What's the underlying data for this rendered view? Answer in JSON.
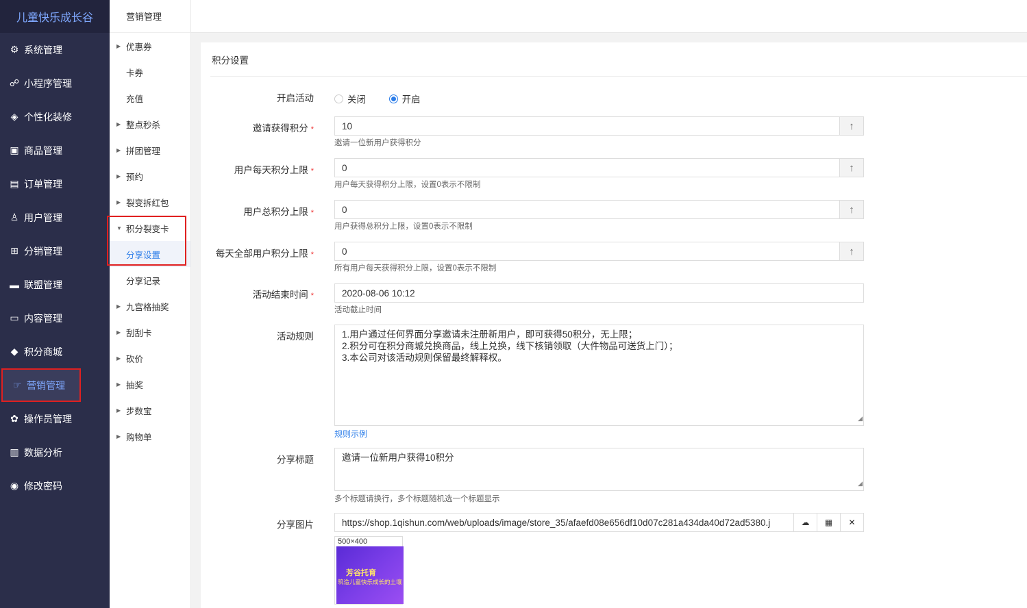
{
  "brand": "儿童快乐成长谷",
  "nav": [
    {
      "label": "系统管理",
      "icon": "gear-icon"
    },
    {
      "label": "小程序管理",
      "icon": "link-icon"
    },
    {
      "label": "个性化装修",
      "icon": "diamond-icon"
    },
    {
      "label": "商品管理",
      "icon": "bag-icon"
    },
    {
      "label": "订单管理",
      "icon": "list-icon"
    },
    {
      "label": "用户管理",
      "icon": "user-icon"
    },
    {
      "label": "分销管理",
      "icon": "tree-icon"
    },
    {
      "label": "联盟管理",
      "icon": "store-icon"
    },
    {
      "label": "内容管理",
      "icon": "content-icon"
    },
    {
      "label": "积分商城",
      "icon": "cube-icon"
    },
    {
      "label": "营销管理",
      "icon": "hand-icon"
    },
    {
      "label": "操作员管理",
      "icon": "cog-icon"
    },
    {
      "label": "数据分析",
      "icon": "chart-icon"
    },
    {
      "label": "修改密码",
      "icon": "shield-icon"
    }
  ],
  "subnav": {
    "head": "营销管理",
    "items": [
      {
        "label": "优惠券"
      },
      {
        "label": "卡券"
      },
      {
        "label": "充值"
      },
      {
        "label": "整点秒杀"
      },
      {
        "label": "拼团管理"
      },
      {
        "label": "预约"
      },
      {
        "label": "裂变拆红包"
      },
      {
        "label": "积分裂变卡"
      },
      {
        "label": "分享设置"
      },
      {
        "label": "分享记录"
      },
      {
        "label": "九宫格抽奖"
      },
      {
        "label": "刮刮卡"
      },
      {
        "label": "砍价"
      },
      {
        "label": "抽奖"
      },
      {
        "label": "步数宝"
      },
      {
        "label": "购物单"
      }
    ]
  },
  "panel": {
    "title": "积分设置",
    "activity": {
      "label": "开启活动",
      "off": "关闭",
      "on": "开启"
    },
    "invite": {
      "label": "邀请获得积分",
      "value": "10",
      "help": "邀请一位新用户获得积分"
    },
    "daily": {
      "label": "用户每天积分上限",
      "value": "0",
      "help": "用户每天获得积分上限，设置0表示不限制"
    },
    "total": {
      "label": "用户总积分上限",
      "value": "0",
      "help": "用户获得总积分上限，设置0表示不限制"
    },
    "all_daily": {
      "label": "每天全部用户积分上限",
      "value": "0",
      "help": "所有用户每天获得积分上限，设置0表示不限制"
    },
    "end_time": {
      "label": "活动结束时间",
      "value": "2020-08-06 10:12",
      "help": "活动截止时间"
    },
    "rules": {
      "label": "活动规则",
      "lines": [
        "1.用户通过任何界面分享邀请未注册新用户，即可获得50积分，无上限；",
        "2.积分可在积分商城兑换商品，线上兑换，线下核销领取（大件物品可送货上门）；",
        "3.本公司对该活动规则保留最终解释权。"
      ],
      "example_link": "规则示例"
    },
    "share_title": {
      "label": "分享标题",
      "value": "邀请一位新用户获得10积分",
      "help": "多个标题请换行，多个标题随机选一个标题显示"
    },
    "share_image": {
      "label": "分享图片",
      "url": "https://shop.1qishun.com/web/uploads/image/store_35/afaefd08e656df10d07c281a434da40d72ad5380.j",
      "size": "500×400",
      "pic_title": "芳谷托育",
      "pic_sub": "筑造儿童快乐成长的土壤"
    }
  },
  "colors": {
    "sidebar": "#2b2e4a",
    "accent": "#2b7de9",
    "highlight": "#e02020"
  }
}
